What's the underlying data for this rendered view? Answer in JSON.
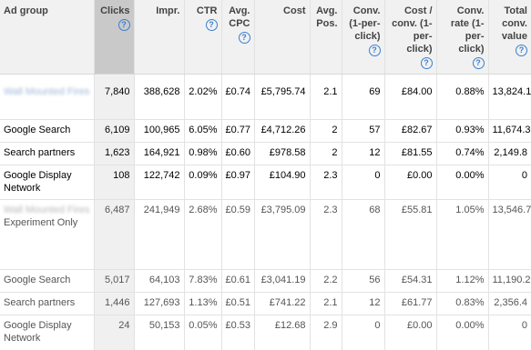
{
  "headers": [
    {
      "key": "adgroup",
      "label": "Ad group",
      "help": false
    },
    {
      "key": "clicks",
      "label": "Clicks",
      "help": true
    },
    {
      "key": "impr",
      "label": "Impr.",
      "help": false
    },
    {
      "key": "ctr",
      "label": "CTR",
      "help": true
    },
    {
      "key": "cpc",
      "label": "Avg. CPC",
      "help": true
    },
    {
      "key": "cost",
      "label": "Cost",
      "help": false
    },
    {
      "key": "pos",
      "label": "Avg. Pos.",
      "help": false
    },
    {
      "key": "conv",
      "label": "Conv. (1-per-click)",
      "help": true
    },
    {
      "key": "cpconv",
      "label": "Cost / conv. (1-per-click)",
      "help": true
    },
    {
      "key": "rate",
      "label": "Conv. rate (1-per-click)",
      "help": true
    },
    {
      "key": "total",
      "label": "Total conv. value",
      "help": true
    }
  ],
  "help_glyph": "?",
  "rows": [
    {
      "name": "Wall Mounted Fires",
      "blurred": true,
      "blur_color": "blue",
      "gray": false,
      "tall": true,
      "values": [
        "7,840",
        "388,628",
        "2.02%",
        "£0.74",
        "£5,795.74",
        "2.1",
        "69",
        "£84.00",
        "0.88%",
        "13,824.1"
      ]
    },
    {
      "name": "Google Search",
      "blurred": false,
      "gray": false,
      "values": [
        "6,109",
        "100,965",
        "6.05%",
        "£0.77",
        "£4,712.26",
        "2",
        "57",
        "£82.67",
        "0.93%",
        "11,674.3"
      ]
    },
    {
      "name": "Search partners",
      "blurred": false,
      "gray": false,
      "values": [
        "1,623",
        "164,921",
        "0.98%",
        "£0.60",
        "£978.58",
        "2",
        "12",
        "£81.55",
        "0.74%",
        "2,149.8"
      ]
    },
    {
      "name": "Google Display Network",
      "blurred": false,
      "gray": false,
      "values": [
        "108",
        "122,742",
        "0.09%",
        "£0.97",
        "£104.90",
        "2.3",
        "0",
        "£0.00",
        "0.00%",
        "0"
      ]
    },
    {
      "name": "Wall Mounted Fires",
      "blurred": true,
      "blur_color": "gray",
      "note": "Experiment Only",
      "gray": true,
      "values": [
        "6,487",
        "241,949",
        "2.68%",
        "£0.59",
        "£3,795.09",
        "2.3",
        "68",
        "£55.81",
        "1.05%",
        "13,546.7"
      ]
    },
    {
      "name": "Google Search",
      "blurred": false,
      "gray": true,
      "values": [
        "5,017",
        "64,103",
        "7.83%",
        "£0.61",
        "£3,041.19",
        "2.2",
        "56",
        "£54.31",
        "1.12%",
        "11,190.2"
      ]
    },
    {
      "name": "Search partners",
      "blurred": false,
      "gray": true,
      "values": [
        "1,446",
        "127,693",
        "1.13%",
        "£0.51",
        "£741.22",
        "2.1",
        "12",
        "£61.77",
        "0.83%",
        "2,356.4"
      ]
    },
    {
      "name": "Google Display Network",
      "blurred": false,
      "gray": true,
      "values": [
        "24",
        "50,153",
        "0.05%",
        "£0.53",
        "£12.68",
        "2.9",
        "0",
        "£0.00",
        "0.00%",
        "0"
      ]
    }
  ]
}
